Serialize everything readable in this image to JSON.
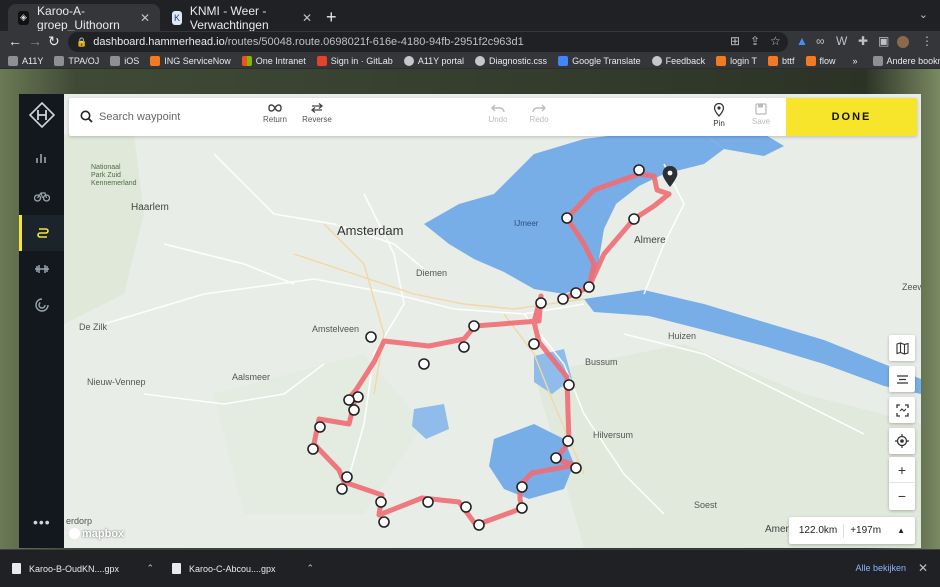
{
  "browser": {
    "tabs": [
      {
        "title": "Karoo-A-groep_Uithoorn",
        "active": true
      },
      {
        "title": "KNMI - Weer - Verwachtingen",
        "active": false
      }
    ],
    "url_host": "dashboard.hammerhead.io",
    "url_path": "/routes/50048.route.0698021f-616e-4180-94fb-2951f2c963d1",
    "bookmarks": [
      "A11Y",
      "TPA/OJ",
      "iOS",
      "ING ServiceNow",
      "One Intranet",
      "Sign in · GitLab",
      "A11Y portal",
      "Diagnostic.css",
      "Google Translate",
      "Feedback",
      "login T",
      "bttf",
      "flow"
    ],
    "bookmarks_more": "»",
    "other_bookmarks": "Andere bookmarks"
  },
  "toolbar": {
    "search_placeholder": "Search waypoint",
    "return_label": "Return",
    "reverse_label": "Reverse",
    "undo_label": "Undo",
    "redo_label": "Redo",
    "pin_label": "Pin",
    "save_label": "Save",
    "done_label": "DONE"
  },
  "map": {
    "labels": {
      "haarlem": "Haarlem",
      "amsterdam": "Amsterdam",
      "ijmeer": "IJmeer",
      "almere": "Almere",
      "diemen": "Diemen",
      "amstelveen": "Amstelveen",
      "huizen": "Huizen",
      "bussum": "Bussum",
      "hilversum": "Hilversum",
      "aalsmeer": "Aalsmeer",
      "nieuw_vennep": "Nieuw-Vennep",
      "de_zilk": "De Zilk",
      "soest": "Soest",
      "amersfoort": "Amers",
      "noordorp": "erdorp",
      "park": "Nationaal\nPark Zuid\nKennemerland",
      "zeew": "Zeew"
    },
    "attribution": "mapbox",
    "route_color": "#ef6b73"
  },
  "stats": {
    "distance": "122.0km",
    "elevation": "+197m"
  },
  "downloads": {
    "items": [
      "Karoo-B-OudKN....gpx",
      "Karoo-C-Abcou....gpx"
    ],
    "show_all": "Alle bekijken"
  }
}
